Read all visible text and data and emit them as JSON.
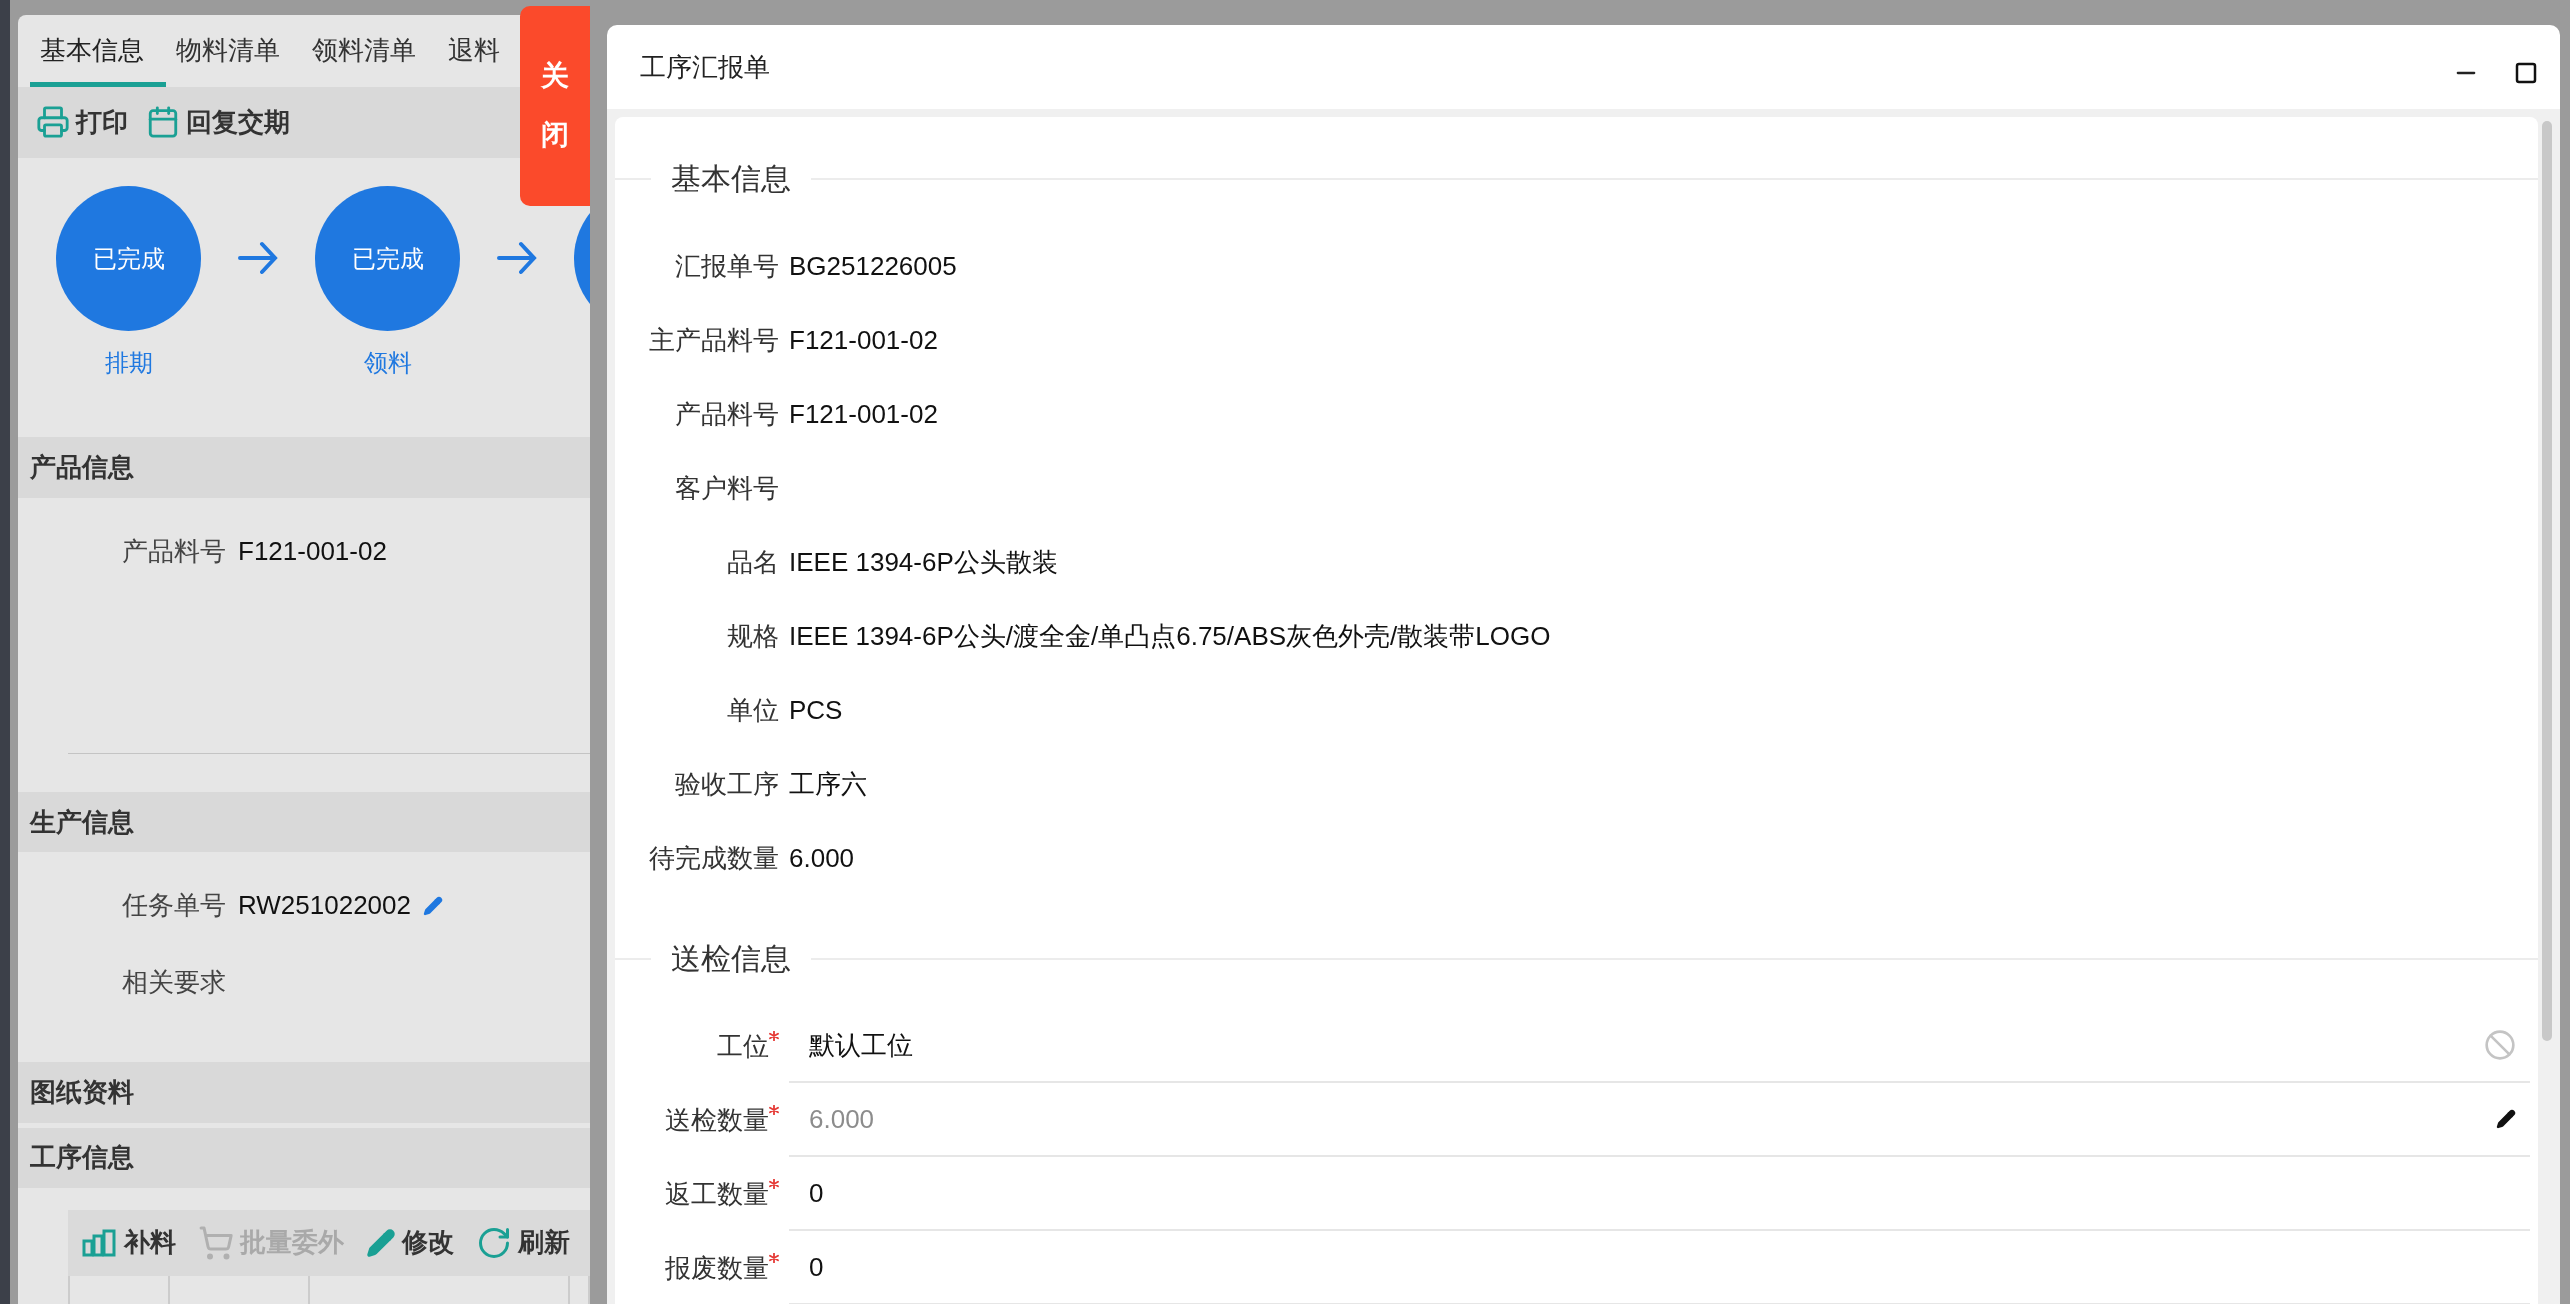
{
  "left_panel": {
    "tabs": [
      {
        "label": "基本信息",
        "selected": true
      },
      {
        "label": "物料清单",
        "selected": false
      },
      {
        "label": "领料清单",
        "selected": false
      },
      {
        "label": "退料",
        "selected": false
      }
    ],
    "toolbar": [
      {
        "kind": "print",
        "label": "打印"
      },
      {
        "kind": "calendar",
        "label": "回复交期"
      }
    ],
    "steps": [
      {
        "status": "已完成",
        "label": "排期"
      },
      {
        "status": "已完成",
        "label": "领料"
      }
    ],
    "sections": [
      {
        "title": "产品信息",
        "fields": [
          {
            "label": "产品料号",
            "value": "F121-001-02"
          }
        ],
        "divider": true
      },
      {
        "title": "生产信息",
        "fields": [
          {
            "label": "任务单号",
            "value": "RW251022002",
            "editable": true
          },
          {
            "label": "相关要求"
          }
        ]
      },
      {
        "title": "图纸资料"
      },
      {
        "title": "工序信息",
        "buttons": [
          {
            "kind": "supply",
            "label": "补料",
            "disabled": false
          },
          {
            "kind": "cart",
            "label": "批量委外",
            "disabled": true
          },
          {
            "kind": "edit",
            "label": "修改",
            "disabled": false
          },
          {
            "kind": "refresh",
            "label": "刷新",
            "disabled": false
          }
        ]
      }
    ]
  },
  "close_tab": "关闭",
  "dialog": {
    "title": "工序汇报单",
    "basic": {
      "title": "基本信息",
      "rows": [
        {
          "label": "汇报单号",
          "value": "BG251226005"
        },
        {
          "label": "主产品料号",
          "value": "F121-001-02"
        },
        {
          "label": "产品料号",
          "value": "F121-001-02"
        },
        {
          "label": "客户料号"
        },
        {
          "label": "品名",
          "value": "IEEE 1394-6P公头散装"
        },
        {
          "label": "规格",
          "value": "IEEE 1394-6P公头/渡全金/单凸点6.75/ABS灰色外壳/散装带LOGO"
        },
        {
          "label": "单位",
          "value": "PCS"
        },
        {
          "label": "验收工序",
          "value": "工序六"
        },
        {
          "label": "待完成数量",
          "value": "6.000"
        }
      ]
    },
    "inspection": {
      "title": "送检信息",
      "fields": [
        {
          "kind": "select",
          "label": "工位",
          "required": true,
          "value": "默认工位"
        },
        {
          "kind": "edit",
          "label": "送检数量",
          "required": true,
          "placeholder": "6.000"
        },
        {
          "kind": "text",
          "label": "返工数量",
          "required": true,
          "value": "0"
        },
        {
          "kind": "text",
          "label": "报废数量",
          "required": true,
          "value": "0"
        }
      ]
    }
  }
}
